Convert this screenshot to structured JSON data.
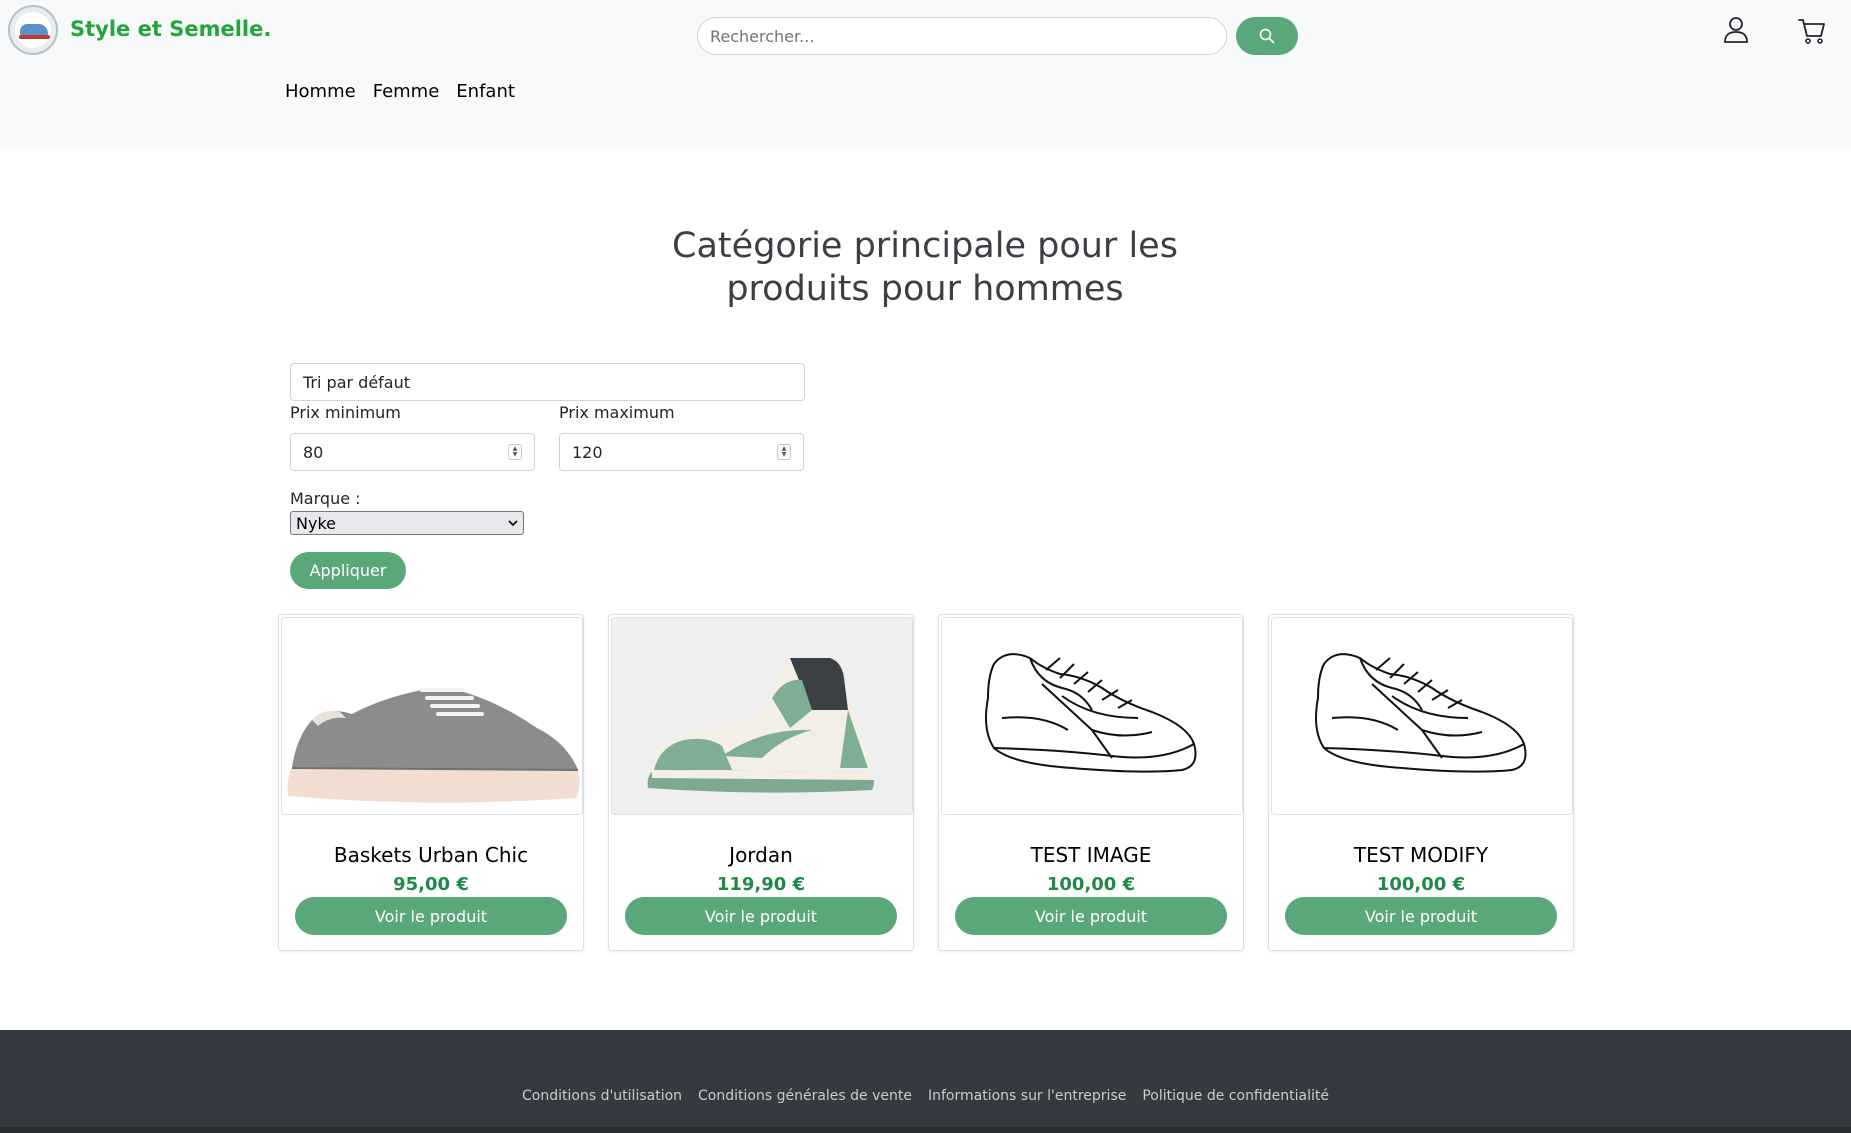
{
  "header": {
    "brand": "Style et Semelle.",
    "search_placeholder": "Rechercher...",
    "nav": [
      "Homme",
      "Femme",
      "Enfant"
    ]
  },
  "main": {
    "title": "Catégorie principale pour les produits pour hommes",
    "sort_value": "Tri par défaut",
    "min_price_label": "Prix minimum",
    "min_price_value": "80",
    "max_price_label": "Prix maximum",
    "max_price_value": "120",
    "brand_label": "Marque :",
    "brand_value": "Nyke",
    "apply_label": "Appliquer"
  },
  "products": [
    {
      "name": "Baskets Urban Chic",
      "price": "95,00 €",
      "button": "Voir le produit",
      "image": "gray-suede-sneaker"
    },
    {
      "name": "Jordan",
      "price": "119,90 €",
      "button": "Voir le produit",
      "image": "green-high-top-sneaker"
    },
    {
      "name": "TEST IMAGE",
      "price": "100,00 €",
      "button": "Voir le produit",
      "image": "sneaker-line-drawing"
    },
    {
      "name": "TEST MODIFY",
      "price": "100,00 €",
      "button": "Voir le produit",
      "image": "sneaker-line-drawing"
    }
  ],
  "footer": {
    "links": [
      "Conditions d'utilisation",
      "Conditions générales de vente",
      "Informations sur l'entreprise",
      "Politique de confidentialité"
    ]
  },
  "colors": {
    "accent": "#5aa879",
    "brand_green": "#24a53a",
    "price_green": "#1f8a45",
    "footer_bg": "#343a40"
  },
  "icons": [
    "logo-icon",
    "search-icon",
    "user-icon",
    "cart-icon",
    "spinner-icon",
    "chevron-down-icon"
  ]
}
